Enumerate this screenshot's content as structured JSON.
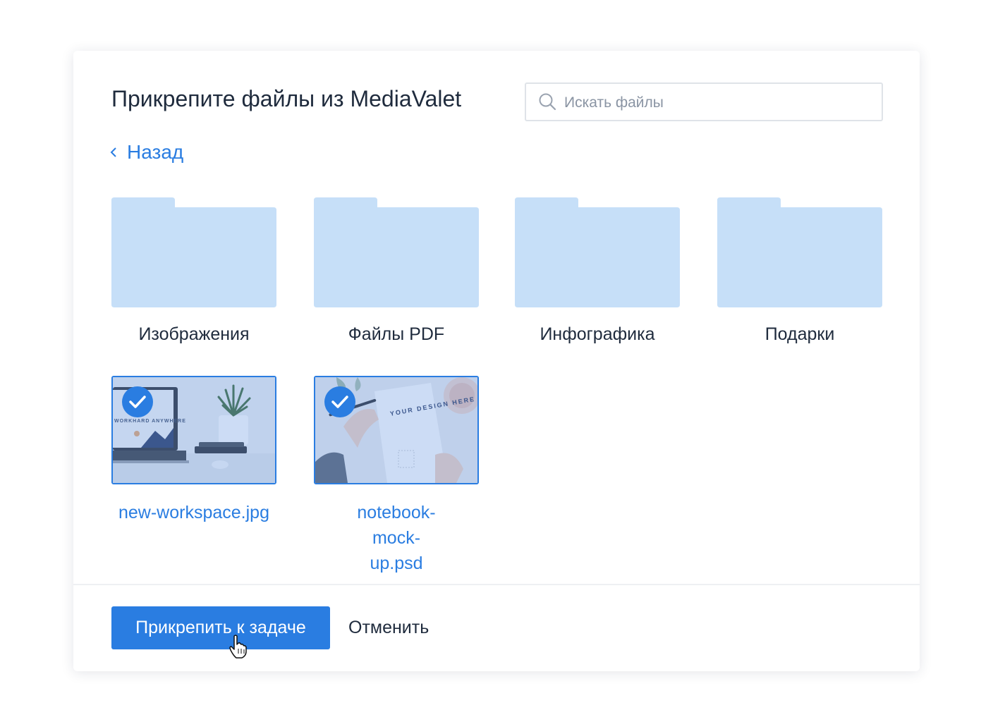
{
  "dialog": {
    "title": "Прикрепите файлы из MediaValet",
    "search": {
      "placeholder": "Искать файлы",
      "icon": "search-icon"
    },
    "back": {
      "label": "Назад",
      "icon": "chevron-left-icon"
    },
    "folders": [
      {
        "label": "Изображения",
        "icon": "folder-icon"
      },
      {
        "label": "Файлы PDF",
        "icon": "folder-icon"
      },
      {
        "label": "Инфографика",
        "icon": "folder-icon"
      },
      {
        "label": "Подарки",
        "icon": "folder-icon"
      }
    ],
    "files": [
      {
        "name": "new-workspace.jpg",
        "selected": true,
        "thumb_text": "WORKHARD ANYWHERE"
      },
      {
        "name": "notebook-mock-up.psd",
        "selected": true,
        "thumb_text": "YOUR DESIGN HERE"
      }
    ],
    "footer": {
      "attach_label": "Прикрепить к задаче",
      "cancel_label": "Отменить"
    }
  },
  "colors": {
    "accent": "#2a7de1",
    "folder": "#c6dff8",
    "text": "#1f2b3d",
    "placeholder": "#8a94a3"
  }
}
